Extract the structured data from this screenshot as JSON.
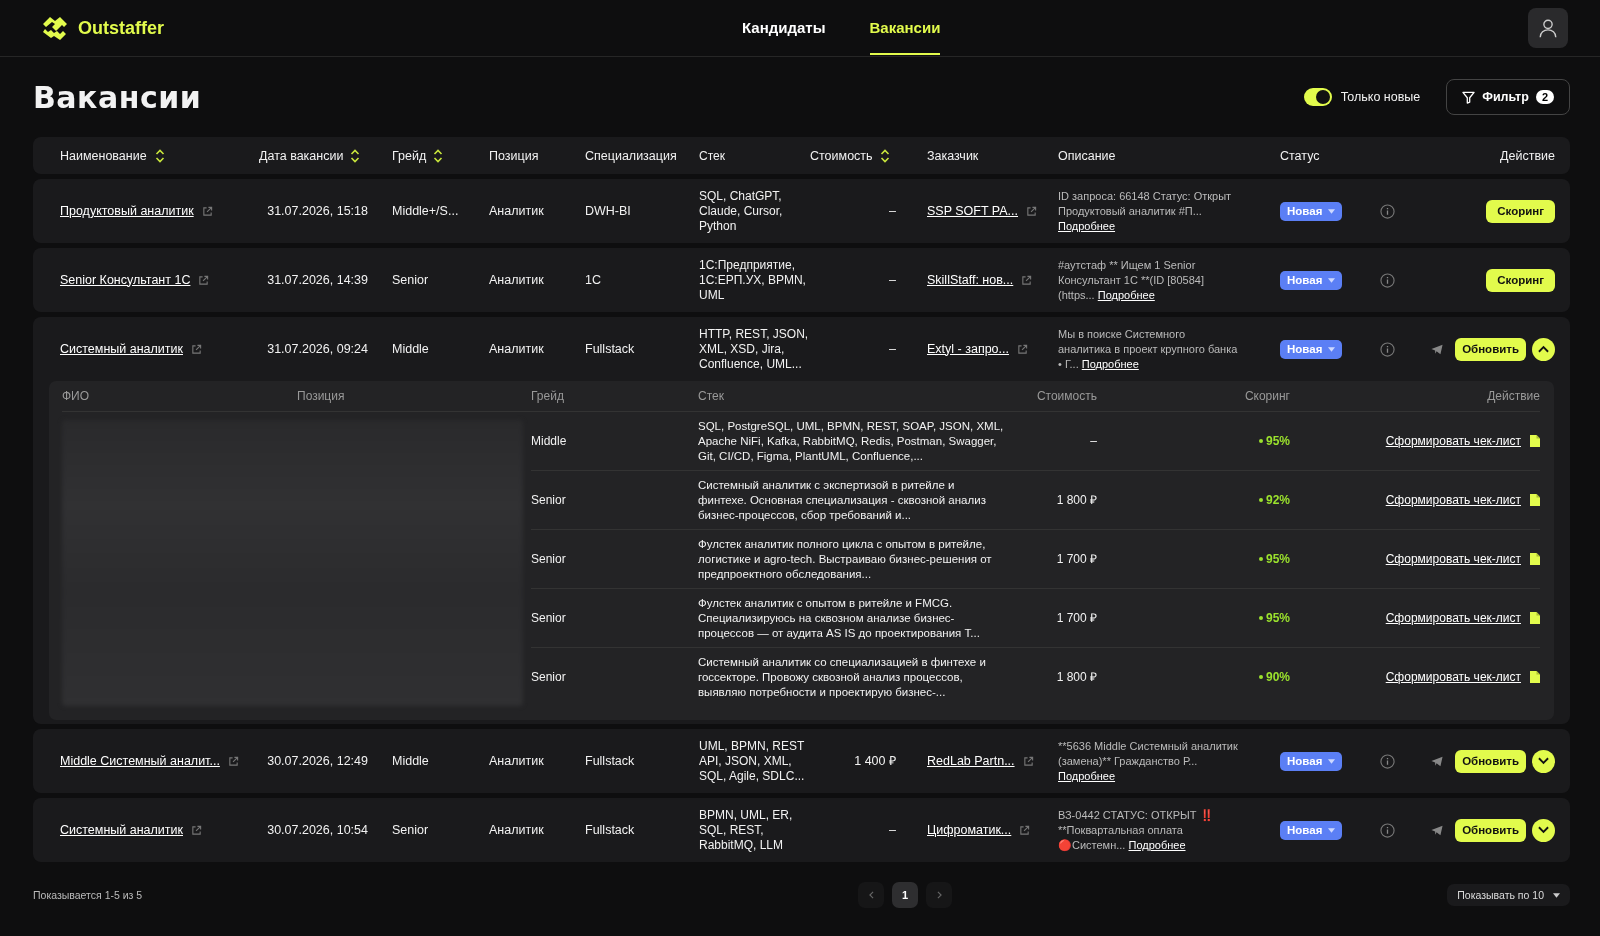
{
  "header": {
    "logo": "Outstaffer",
    "nav": [
      {
        "label": "Кандидаты",
        "selected": false
      },
      {
        "label": "Вакансии",
        "selected": true
      }
    ]
  },
  "page": {
    "title": "Вакансии",
    "toggle": {
      "label": "Только новые",
      "on": true
    },
    "filter": {
      "label": "Фильтр",
      "count": "2"
    }
  },
  "table": {
    "columns": [
      {
        "label": "Наименование",
        "sortable": true
      },
      {
        "label": "Дата вакансии",
        "sortable": true
      },
      {
        "label": "Грейд",
        "sortable": true
      },
      {
        "label": "Позиция",
        "sortable": false
      },
      {
        "label": "Специализация",
        "sortable": false
      },
      {
        "label": "Стек",
        "sortable": false
      },
      {
        "label": "Стоимость",
        "sortable": true
      },
      {
        "label": "Заказчик",
        "sortable": false
      },
      {
        "label": "Описание",
        "sortable": false
      },
      {
        "label": "Статус",
        "sortable": false
      },
      {
        "label": "Действие",
        "sortable": false
      }
    ],
    "rows": [
      {
        "name": "Продуктовый аналитик",
        "date": "31.07.2026, 15:18",
        "grade": "Middle+/S...",
        "position": "Аналитик",
        "specialization": "DWH-BI",
        "stack": "SQL, ChatGPT, Claude, Cursor, Python",
        "cost": "–",
        "customer": "SSP SOFT PA...",
        "description": "ID запроса: 66148 Статус: Открыт Продуктовый аналитик #П...",
        "more": "Подробнее",
        "status": "Новая",
        "kind": "scoring",
        "action": "Скоринг"
      },
      {
        "name": "Senior Консультант 1С",
        "date": "31.07.2026, 14:39",
        "grade": "Senior",
        "position": "Аналитик",
        "specialization": "1C",
        "stack": "1С:Предприятие, 1С:ЕРП.УХ, BPMN, UML",
        "cost": "–",
        "customer": "SkillStaff: нов...",
        "description": "#аутстаф ** Ищем 1 Senior Консультант 1С **(ID [80584] (https...",
        "more": "Подробнее",
        "status": "Новая",
        "kind": "scoring",
        "action": "Скоринг"
      },
      {
        "name": "Системный аналитик",
        "date": "31.07.2026, 09:24",
        "grade": "Middle",
        "position": "Аналитик",
        "specialization": "Fullstack",
        "stack": "HTTP, REST, JSON, XML, XSD, Jira, Confluence, UML...",
        "cost": "–",
        "customer": "Extyl - запро...",
        "description": "Мы в поиске Системного аналитика в проект крупного банка • Г...",
        "more": "Подробнее",
        "status": "Новая",
        "kind": "update",
        "action": "Обновить",
        "expanded": true,
        "candidates": {
          "columns": [
            "ФИО",
            "Позиция",
            "Грейд",
            "Стек",
            "Стоимость",
            "Скоринг",
            "Действие"
          ],
          "rows": [
            {
              "grade": "Middle",
              "stack": "SQL, PostgreSQL, UML, BPMN, REST, SOAP, JSON, XML, Apache NiFi, Kafka, RabbitMQ, Redis, Postman, Swagger, Git, CI/CD, Figma, PlantUML, Confluence,...",
              "cost": "–",
              "score": "95%",
              "action": "Сформировать чек-лист"
            },
            {
              "grade": "Senior",
              "stack": "Системный аналитик с экспертизой в ритейле и финтехе. Основная специализация - сквозной анализ бизнес-процессов, сбор требований и...",
              "cost": "1 800 ₽",
              "score": "92%",
              "action": "Сформировать чек-лист"
            },
            {
              "grade": "Senior",
              "stack": "Фулстек аналитик полного цикла с опытом в ритейле, логистике и agro-tech. Выстраиваю бизнес-решения от предпроектного обследования...",
              "cost": "1 700 ₽",
              "score": "95%",
              "action": "Сформировать чек-лист"
            },
            {
              "grade": "Senior",
              "stack": "Фулстек аналитик с опытом в ритейле и FMCG. Специализируюсь на сквозном анализе бизнес-процессов — от аудита AS IS до проектирования T...",
              "cost": "1 700 ₽",
              "score": "95%",
              "action": "Сформировать чек-лист"
            },
            {
              "grade": "Senior",
              "stack": "Системный аналитик со специализацией в финтехе и госсекторе. Провожу сквозной анализ процессов, выявляю потребности и проектирую бизнес-...",
              "cost": "1 800 ₽",
              "score": "90%",
              "action": "Сформировать чек-лист"
            }
          ]
        }
      },
      {
        "name": "Middle Системный аналит...",
        "date": "30.07.2026, 12:49",
        "grade": "Middle",
        "position": "Аналитик",
        "specialization": "Fullstack",
        "stack": "UML, BPMN, REST API, JSON, XML, SQL, Agile, SDLC...",
        "cost": "1 400 ₽",
        "customer": "RedLab Partn...",
        "description": "**5636 Middle Системный аналитик (замена)** Гражданство Р...",
        "more": "Подробнее",
        "status": "Новая",
        "kind": "update",
        "action": "Обновить",
        "expanded": false
      },
      {
        "name": "Системный аналитик",
        "date": "30.07.2026, 10:54",
        "grade": "Senior",
        "position": "Аналитик",
        "specialization": "Fullstack",
        "stack": "BPMN, UML, ER, SQL, REST, RabbitMQ, LLM",
        "cost": "–",
        "customer": "Цифроматик...",
        "description": "ВЗ-0442 СТАТУС: ОТКРЫТ ‼️ **Поквартальная оплата 🔴Системн...",
        "more": "Подробнее",
        "status": "Новая",
        "kind": "update",
        "action": "Обновить",
        "expanded": false
      }
    ]
  },
  "footer": {
    "summary": "Показывается 1-5 из 5",
    "pages": [
      {
        "label": "1",
        "selected": true
      }
    ],
    "page_size": "Показывать по 10"
  }
}
